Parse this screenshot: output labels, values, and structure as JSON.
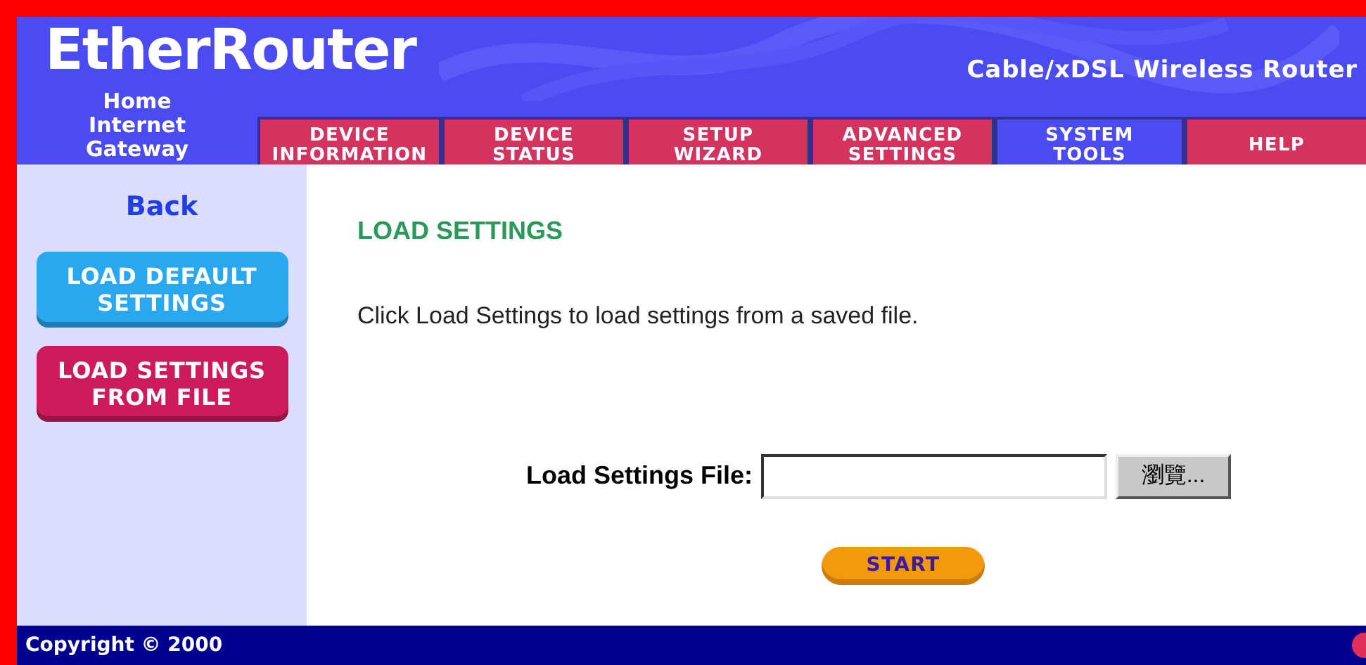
{
  "header": {
    "logo": "EtherRouter",
    "subtitle": "Home Internet Gateway",
    "tagline": "Cable/xDSL Wireless Router"
  },
  "tabs": [
    {
      "label": "DEVICE INFORMATION",
      "selected": false
    },
    {
      "label": "DEVICE STATUS",
      "selected": false
    },
    {
      "label": "SETUP WIZARD",
      "selected": false
    },
    {
      "label": "ADVANCED SETTINGS",
      "selected": false
    },
    {
      "label": "SYSTEM TOOLS",
      "selected": true
    },
    {
      "label": "HELP",
      "selected": false
    }
  ],
  "sidebar": {
    "back": "Back",
    "items": [
      {
        "label": "LOAD DEFAULT SETTINGS",
        "selected": false
      },
      {
        "label": "LOAD SETTINGS FROM FILE",
        "selected": true
      }
    ]
  },
  "content": {
    "title": "LOAD SETTINGS",
    "description": "Click Load Settings to load settings from a saved file.",
    "field_label": "Load Settings File:",
    "browse_button": "瀏覽...",
    "start_button": "START"
  },
  "footer": {
    "copyright": "Copyright © 2000"
  }
}
